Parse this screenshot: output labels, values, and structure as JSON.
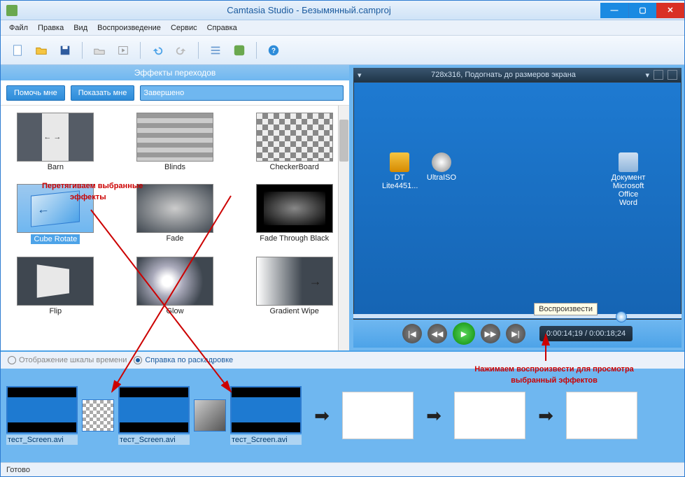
{
  "window": {
    "title": "Camtasia Studio - Безымянный.camproj"
  },
  "menu": {
    "file": "Файл",
    "edit": "Правка",
    "view": "Вид",
    "play": "Воспроизведение",
    "tools": "Сервис",
    "help": "Справка"
  },
  "panel": {
    "title": "Эффекты переходов",
    "help_me": "Помочь мне",
    "show_me": "Показать мне",
    "done": "Завершено"
  },
  "transitions": [
    {
      "label": "Barn"
    },
    {
      "label": "Blinds"
    },
    {
      "label": "CheckerBoard"
    },
    {
      "label": "Cube Rotate",
      "selected": true
    },
    {
      "label": "Fade"
    },
    {
      "label": "Fade Through Black"
    },
    {
      "label": "Flip"
    },
    {
      "label": "Glow"
    },
    {
      "label": "Gradient Wipe"
    }
  ],
  "preview": {
    "info": "728x316, Подогнать до размеров экрана",
    "time": "0:00:14;19 / 0:00:18;24",
    "tooltip": "Воспроизвести",
    "icons": [
      {
        "label": "DT Lite4451..."
      },
      {
        "label": "UltraISO"
      },
      {
        "label": "Документ Microsoft Office Word"
      }
    ]
  },
  "timeline": {
    "opt_timeline": "Отображение шкалы времени",
    "opt_storyboard": "Справка по раскадровке",
    "clips": [
      {
        "label": "тест_Screen.avi"
      },
      {
        "label": "тест_Screen.avi"
      },
      {
        "label": "тест_Screen.avi"
      }
    ]
  },
  "status": "Готово",
  "annotations": {
    "a1_line1": "Перетягиваем выбранные",
    "a1_line2": "эффекты",
    "a2_line1": "Нажимаем воспроизвести для просмотра",
    "a2_line2": "выбранный эффектов"
  }
}
